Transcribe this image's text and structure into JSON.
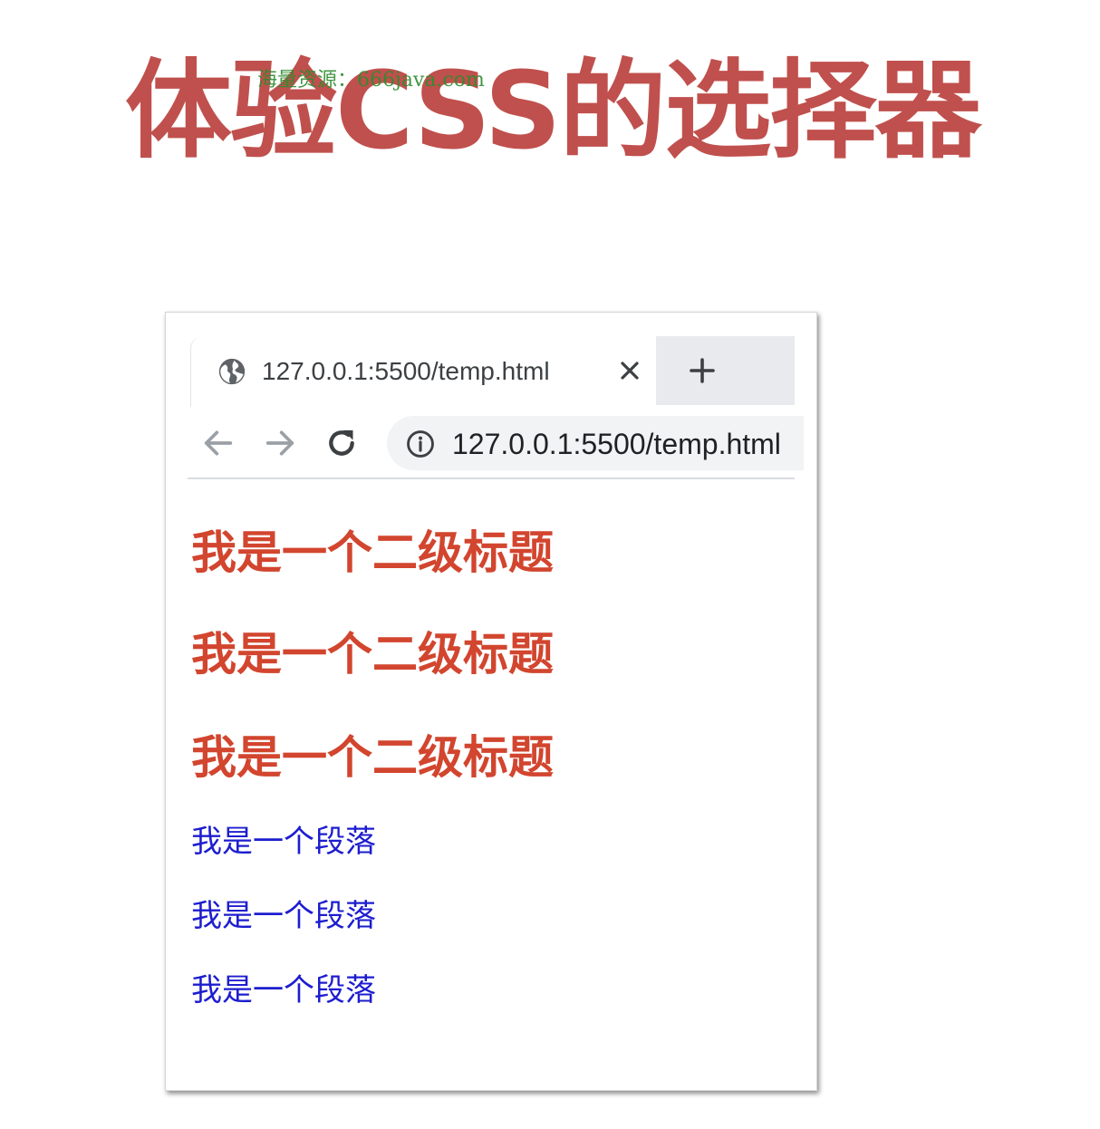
{
  "slide": {
    "title": "体验CSS的选择器",
    "watermark": "海量资源：666java.com",
    "title_color": "#c0504d"
  },
  "browser": {
    "tab": {
      "title": "127.0.0.1:5500/temp.html",
      "icon": "globe-icon",
      "close_icon": "close-icon"
    },
    "new_tab_icon": "plus-icon",
    "toolbar": {
      "back_icon": "arrow-left-icon",
      "forward_icon": "arrow-right-icon",
      "reload_icon": "reload-icon",
      "site_info_icon": "info-icon",
      "url": "127.0.0.1:5500/temp.html"
    }
  },
  "page": {
    "headings": [
      "我是一个二级标题",
      "我是一个二级标题",
      "我是一个二级标题"
    ],
    "paragraphs": [
      "我是一个段落",
      "我是一个段落",
      "我是一个段落"
    ],
    "heading_color": "#d2452e",
    "paragraph_color": "#1d1dcf"
  }
}
